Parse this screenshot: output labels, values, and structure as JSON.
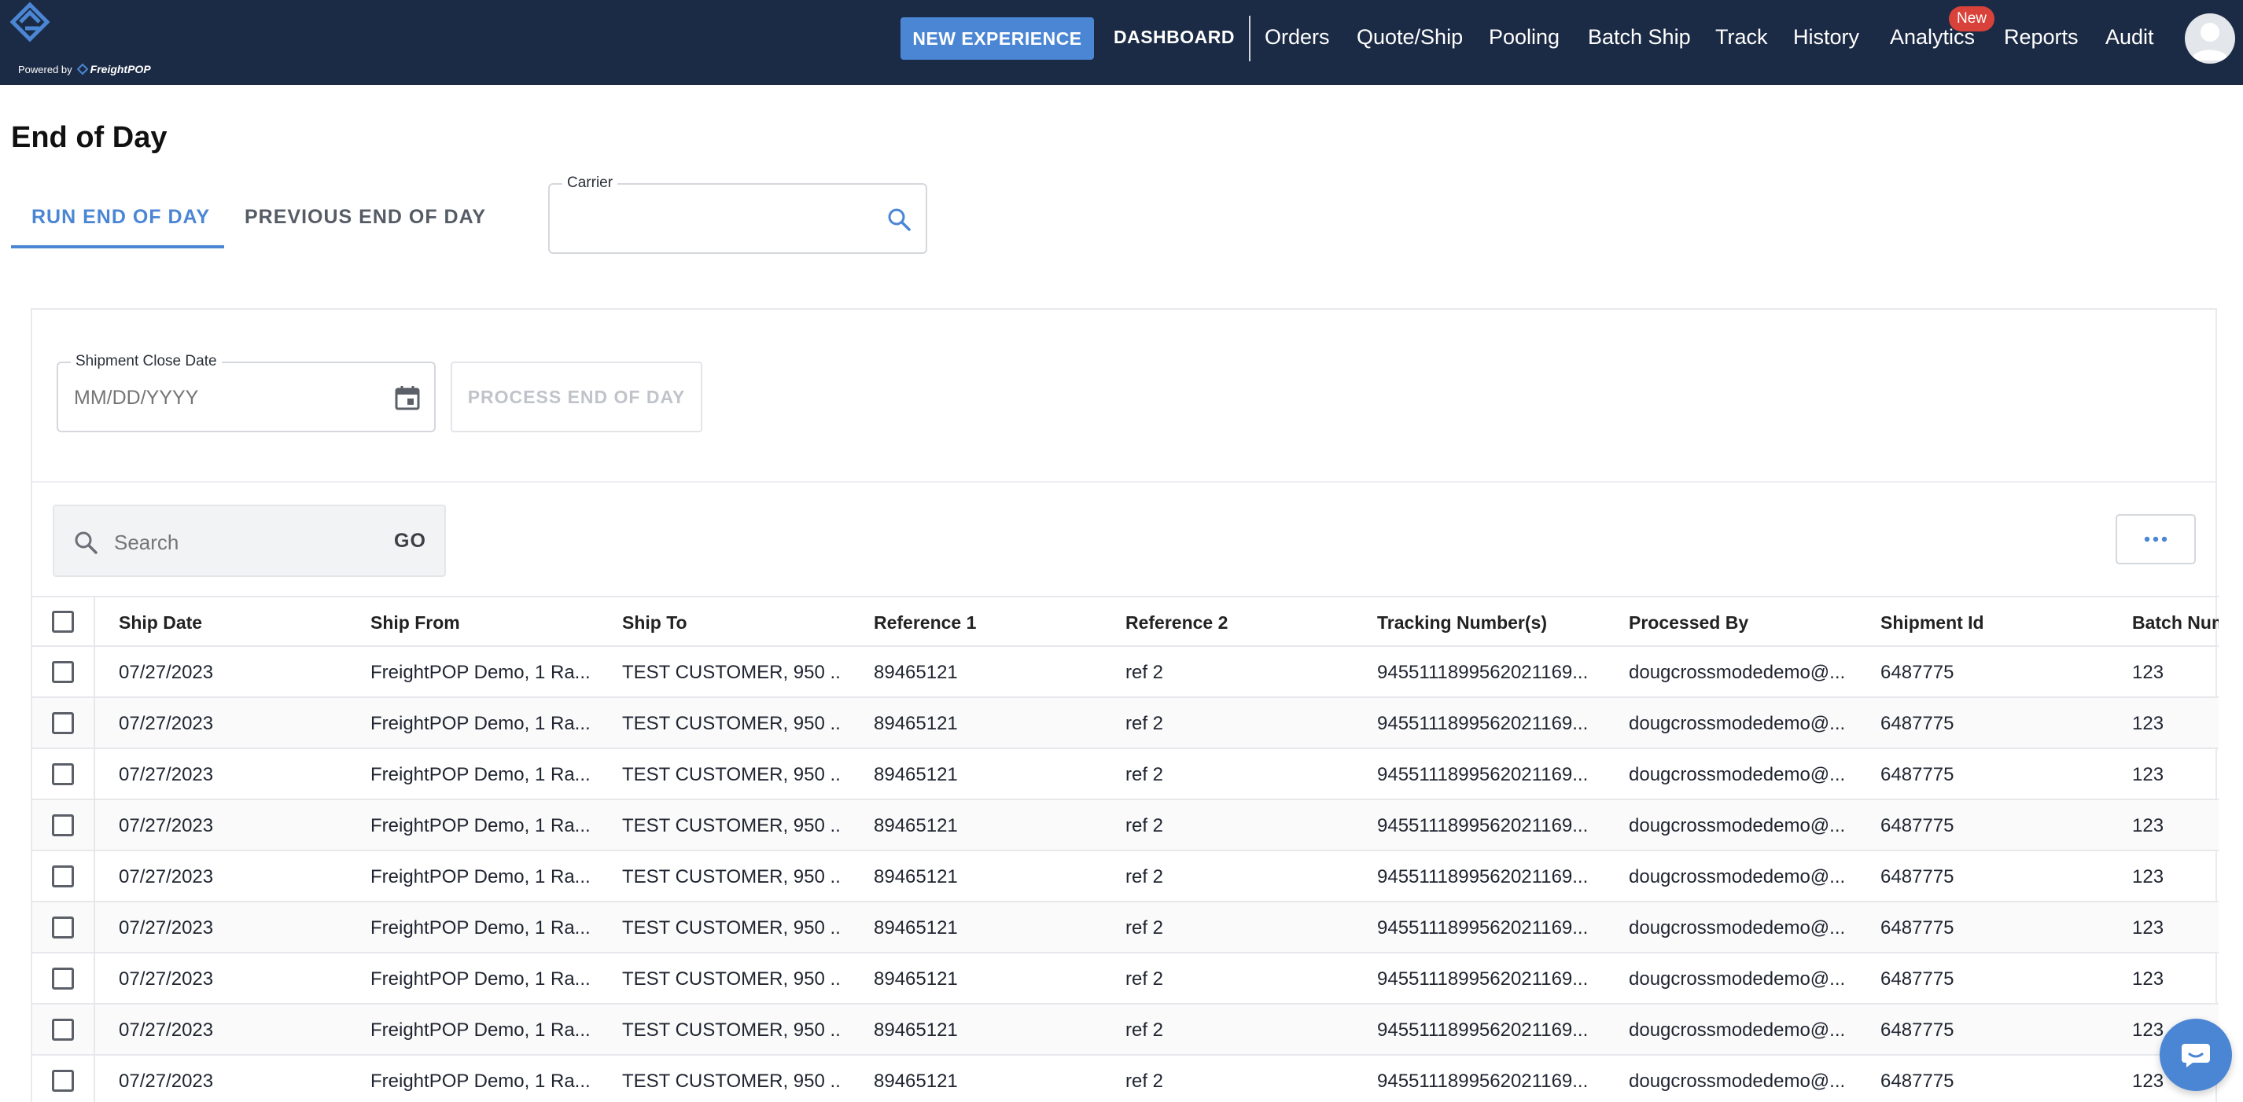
{
  "brand": {
    "powered_by": "Powered by",
    "product": "FreightPOP"
  },
  "topnav": {
    "new_experience": "NEW EXPERIENCE",
    "dashboard": "DASHBOARD",
    "items": [
      "Orders",
      "Quote/Ship",
      "Pooling",
      "Batch Ship",
      "Track",
      "History",
      "Analytics",
      "Reports",
      "Audit"
    ],
    "analytics_badge": "New"
  },
  "page": {
    "title": "End of Day",
    "tabs": [
      "RUN END OF DAY",
      "PREVIOUS END OF DAY"
    ],
    "carrier_label": "Carrier",
    "carrier_value": ""
  },
  "form": {
    "close_date_label": "Shipment Close Date",
    "close_date_placeholder": "MM/DD/YYYY",
    "process_button": "PROCESS END OF DAY"
  },
  "search": {
    "placeholder": "Search",
    "go": "GO"
  },
  "table": {
    "columns": [
      "Ship Date",
      "Ship From",
      "Ship To",
      "Reference 1",
      "Reference 2",
      "Tracking Number(s)",
      "Processed By",
      "Shipment Id",
      "Batch Num"
    ],
    "rows": [
      [
        "07/27/2023",
        "FreightPOP Demo, 1 Ra...",
        "TEST CUSTOMER, 950 ...",
        "89465121",
        "ref 2",
        "9455111899562021169...",
        "dougcrossmodedemo@...",
        "6487775",
        "123"
      ],
      [
        "07/27/2023",
        "FreightPOP Demo, 1 Ra...",
        "TEST CUSTOMER, 950 ...",
        "89465121",
        "ref 2",
        "9455111899562021169...",
        "dougcrossmodedemo@...",
        "6487775",
        "123"
      ],
      [
        "07/27/2023",
        "FreightPOP Demo, 1 Ra...",
        "TEST CUSTOMER, 950 ...",
        "89465121",
        "ref 2",
        "9455111899562021169...",
        "dougcrossmodedemo@...",
        "6487775",
        "123"
      ],
      [
        "07/27/2023",
        "FreightPOP Demo, 1 Ra...",
        "TEST CUSTOMER, 950 ...",
        "89465121",
        "ref 2",
        "9455111899562021169...",
        "dougcrossmodedemo@...",
        "6487775",
        "123"
      ],
      [
        "07/27/2023",
        "FreightPOP Demo, 1 Ra...",
        "TEST CUSTOMER, 950 ...",
        "89465121",
        "ref 2",
        "9455111899562021169...",
        "dougcrossmodedemo@...",
        "6487775",
        "123"
      ],
      [
        "07/27/2023",
        "FreightPOP Demo, 1 Ra...",
        "TEST CUSTOMER, 950 ...",
        "89465121",
        "ref 2",
        "9455111899562021169...",
        "dougcrossmodedemo@...",
        "6487775",
        "123"
      ],
      [
        "07/27/2023",
        "FreightPOP Demo, 1 Ra...",
        "TEST CUSTOMER, 950 ...",
        "89465121",
        "ref 2",
        "9455111899562021169...",
        "dougcrossmodedemo@...",
        "6487775",
        "123"
      ],
      [
        "07/27/2023",
        "FreightPOP Demo, 1 Ra...",
        "TEST CUSTOMER, 950 ...",
        "89465121",
        "ref 2",
        "9455111899562021169...",
        "dougcrossmodedemo@...",
        "6487775",
        "123"
      ],
      [
        "07/27/2023",
        "FreightPOP Demo, 1 Ra...",
        "TEST CUSTOMER, 950 ...",
        "89465121",
        "ref 2",
        "9455111899562021169...",
        "dougcrossmodedemo@...",
        "6487775",
        "123"
      ]
    ]
  },
  "colors": {
    "topbar": "#1c2b45",
    "accent": "#4b86d4",
    "badge": "#d9423a"
  },
  "icons": [
    "freightpop-logo-icon",
    "user-avatar-icon",
    "search-icon",
    "calendar-icon",
    "more-horizontal-icon",
    "chat-icon"
  ]
}
